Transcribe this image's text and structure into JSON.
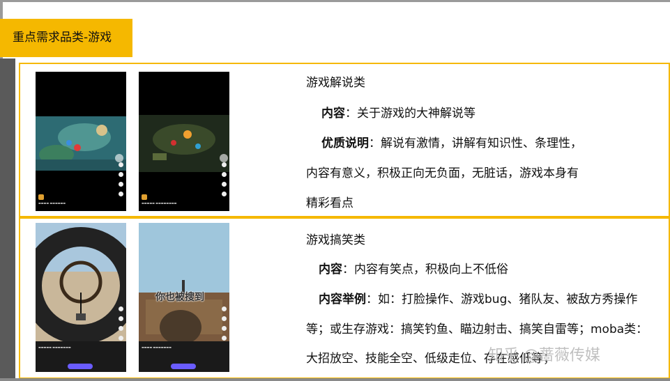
{
  "header": {
    "title": "重点需求品类-游戏"
  },
  "sections": [
    {
      "category": "游戏解说类",
      "content_label": "内容",
      "content_text": "：关于游戏的大神解说等",
      "quality_label": "优质说明",
      "quality_text_1": "：解说有激情，讲解有知识性、条理性，",
      "quality_text_2": "内容有意义，积极正向无负面，无脏话，游戏本身有",
      "quality_text_3": "精彩看点"
    },
    {
      "category": "游戏搞笑类",
      "content_label": "内容",
      "content_text": "：内容有笑点，积极向上不低俗",
      "example_label": "内容举例",
      "example_text_1": "：如：打脸操作、游戏bug、猪队友、被敌方秀操作",
      "example_text_2": "等；或生存游戏：搞笑钓鱼、瞄边射击、搞笑自雷等；moba类：",
      "example_text_3": "大招放空、技能全空、低级走位、存在感低等；"
    }
  ],
  "thumbnails": {
    "overlay_text": "你也被搜到",
    "colors": {
      "moba_ground": "#2d6b73",
      "moba_dark": "#1f2a1c",
      "sky": "#9fc6dc",
      "wall": "#7b5a3e"
    }
  },
  "watermark": "知乎 @蔷薇传媒",
  "colors": {
    "accent": "#f5b800",
    "frame": "#9a9a9a",
    "sidebar": "#5a5a5a"
  }
}
